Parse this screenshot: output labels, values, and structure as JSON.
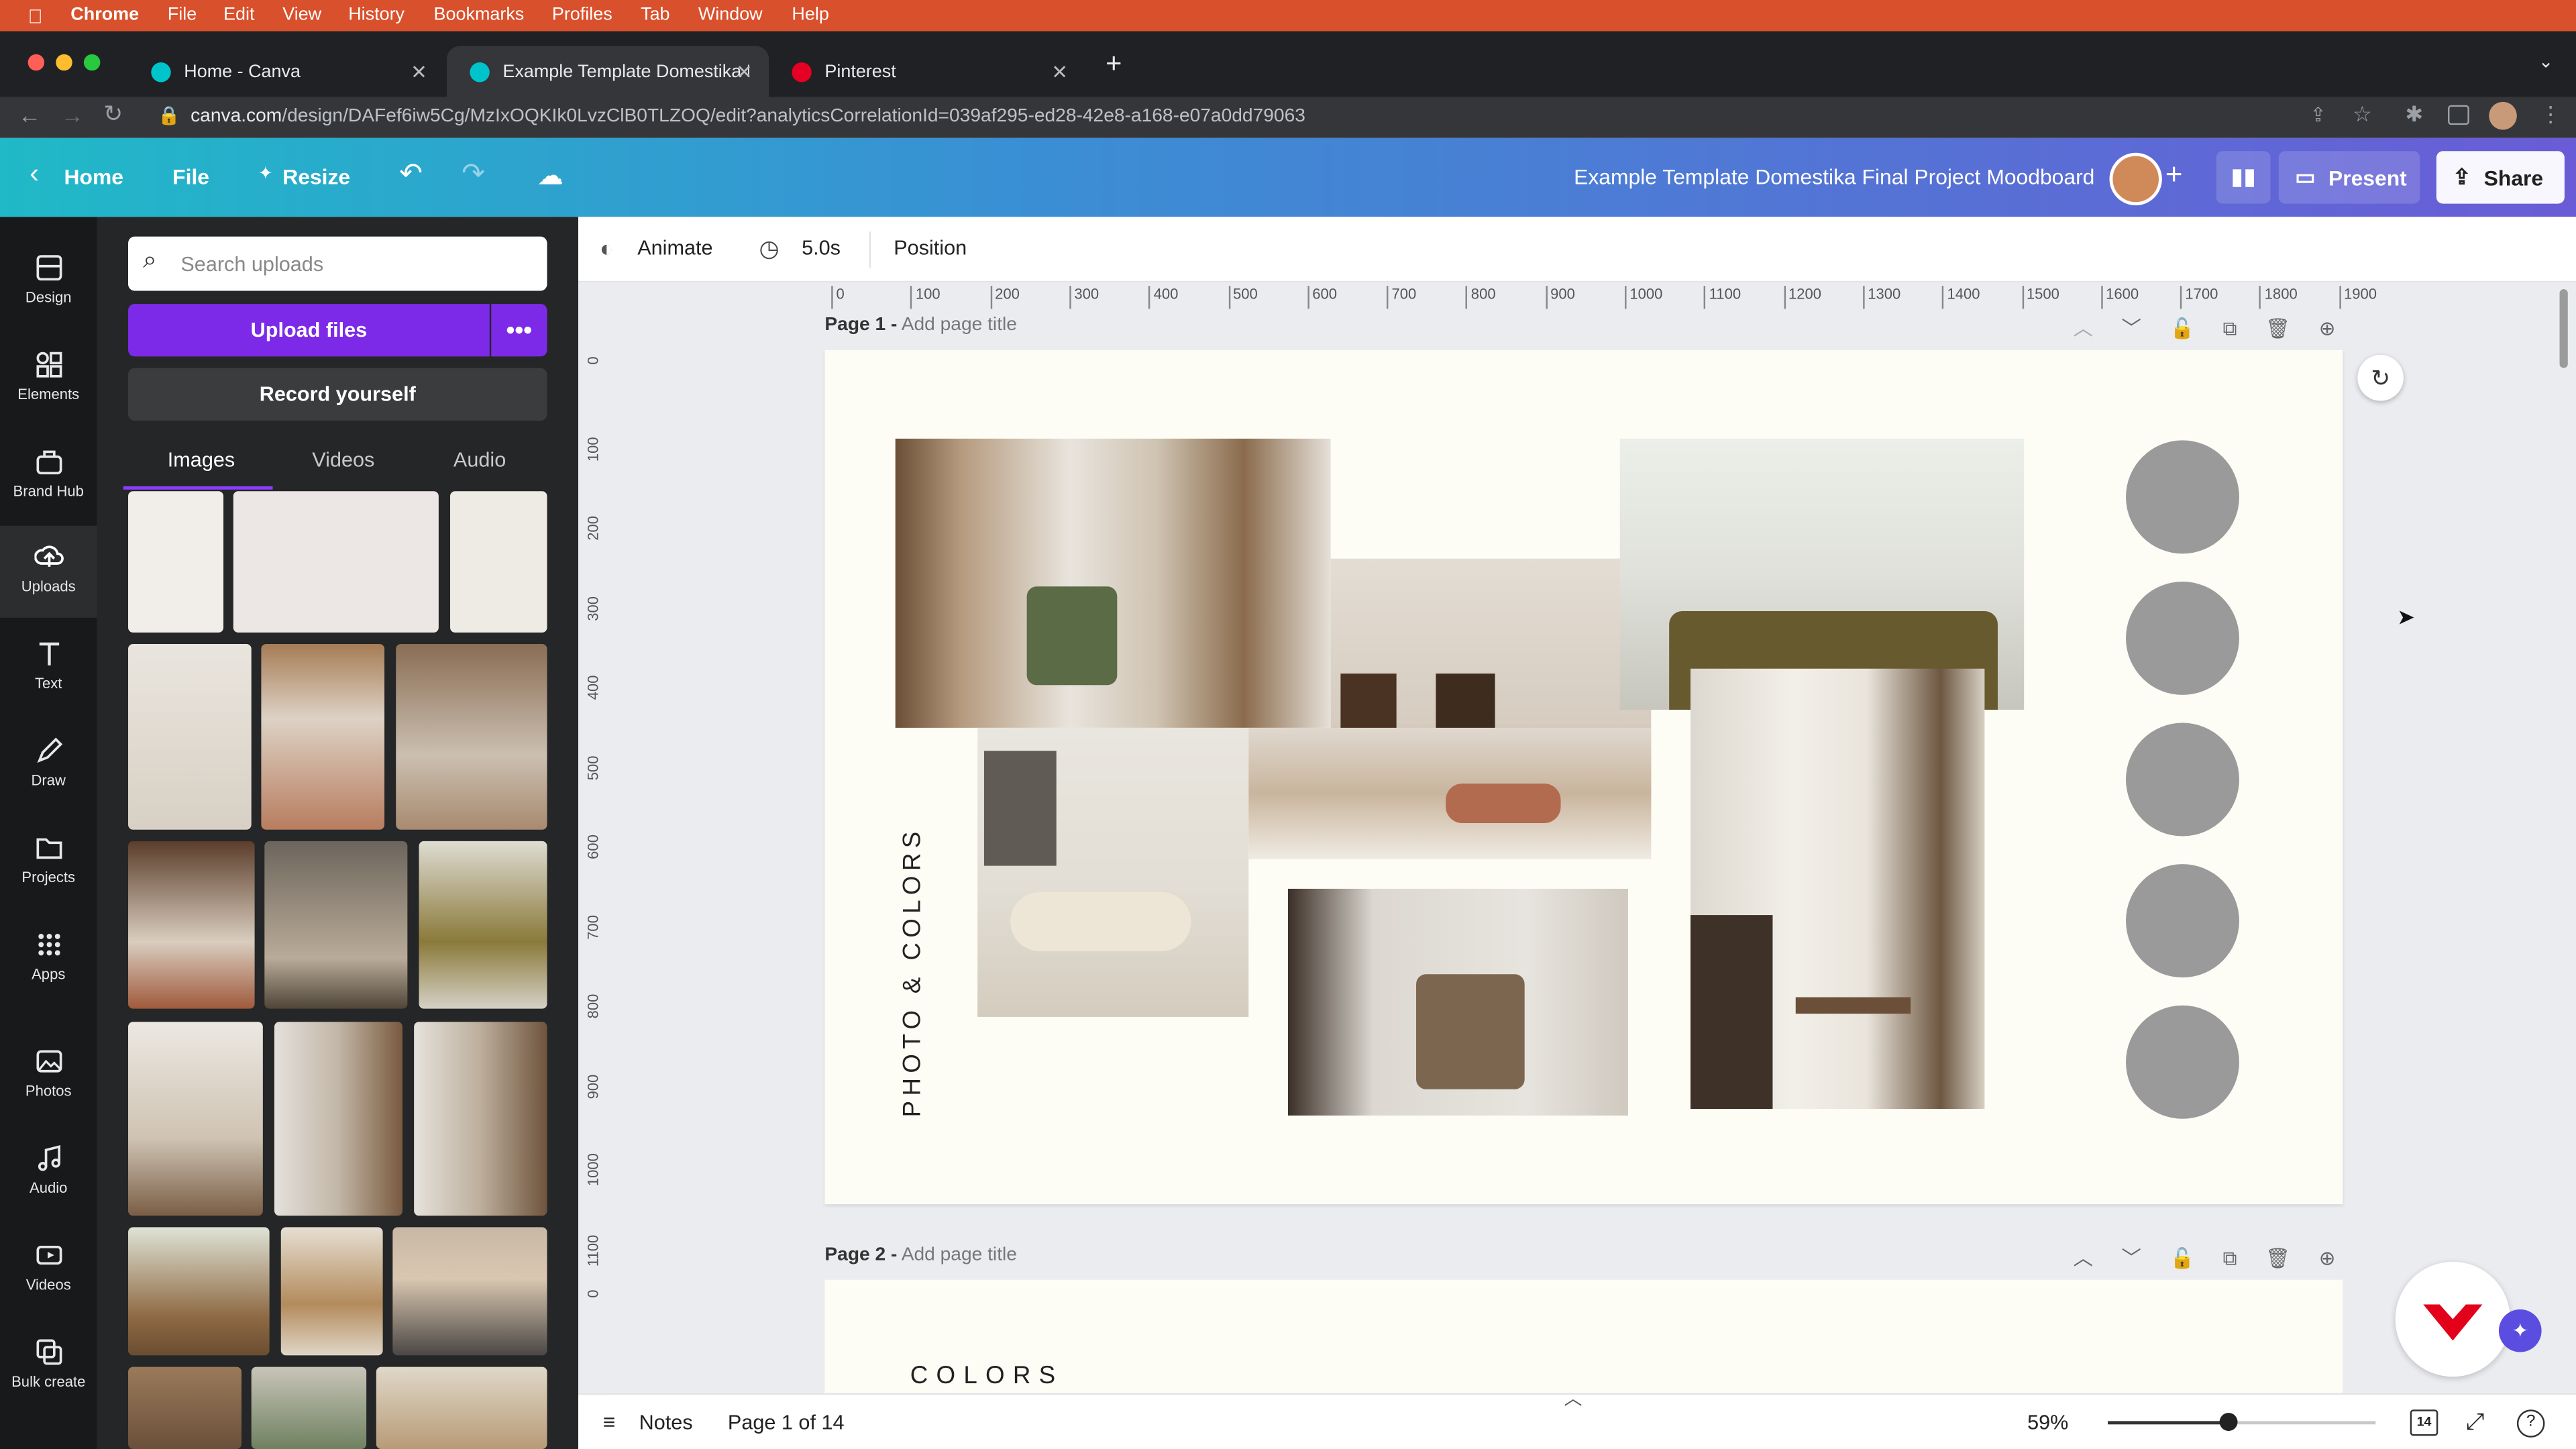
{
  "menubar": {
    "app": "Chrome",
    "items": [
      "File",
      "Edit",
      "View",
      "History",
      "Bookmarks",
      "Profiles",
      "Tab",
      "Window",
      "Help"
    ]
  },
  "tabs": [
    {
      "title": "Home - Canva",
      "color": "#00c4cc"
    },
    {
      "title": "Example Template Domestika F",
      "color": "#00c4cc"
    },
    {
      "title": "Pinterest",
      "color": "#e60023"
    }
  ],
  "address": {
    "url": "canva.com/design/DAFef6iw5Cg/MzIxOQKIk0LvzClB0TLZOQ/edit?analyticsCorrelationId=039af295-ed28-42e8-a168-e07a0dd79063",
    "url_dim_prefix": "canva.com",
    "url_rest": "/design/DAFef6iw5Cg/MzIxOQKIk0LvzClB0TLZOQ/edit?analyticsCorrelationId=039af295-ed28-42e8-a168-e07a0dd79063"
  },
  "header": {
    "home": "Home",
    "file": "File",
    "resize": "Resize",
    "doc_title": "Example Template Domestika Final Project Moodboard",
    "present": "Present",
    "share": "Share"
  },
  "rail": [
    {
      "label": "Design",
      "icon": "design-icon"
    },
    {
      "label": "Elements",
      "icon": "elements-icon"
    },
    {
      "label": "Brand Hub",
      "icon": "brand-hub-icon"
    },
    {
      "label": "Uploads",
      "icon": "uploads-icon"
    },
    {
      "label": "Text",
      "icon": "text-icon"
    },
    {
      "label": "Draw",
      "icon": "draw-icon"
    },
    {
      "label": "Projects",
      "icon": "projects-icon"
    },
    {
      "label": "Apps",
      "icon": "apps-icon"
    },
    {
      "label": "Photos",
      "icon": "photos-icon"
    },
    {
      "label": "Audio",
      "icon": "audio-icon"
    },
    {
      "label": "Videos",
      "icon": "videos-icon"
    },
    {
      "label": "Bulk create",
      "icon": "bulk-create-icon"
    }
  ],
  "panel": {
    "search_placeholder": "Search uploads",
    "upload_btn": "Upload files",
    "record_btn": "Record yourself",
    "tabs": [
      "Images",
      "Videos",
      "Audio"
    ]
  },
  "toolbar": {
    "animate": "Animate",
    "duration": "5.0s",
    "position": "Position"
  },
  "ruler": {
    "h": [
      "0",
      "100",
      "200",
      "300",
      "400",
      "500",
      "600",
      "700",
      "800",
      "900",
      "1000",
      "1100",
      "1200",
      "1300",
      "1400",
      "1500",
      "1600",
      "1700",
      "1800",
      "1900"
    ],
    "v": [
      "0",
      "100",
      "200",
      "300",
      "400",
      "500",
      "600",
      "700",
      "800",
      "900",
      "1000",
      "1100",
      "0"
    ]
  },
  "pages": {
    "p1_label": "Page 1 -",
    "p1_title": "Add page title",
    "p2_label": "Page 2 -",
    "p2_title": "Add page title",
    "vertical_text": "PHOTO & COLORS",
    "p2_peek": "COLORS"
  },
  "bottom": {
    "notes": "Notes",
    "page_of": "Page 1 of 14",
    "zoom": "59%",
    "page_count": "14",
    "help": "?"
  }
}
